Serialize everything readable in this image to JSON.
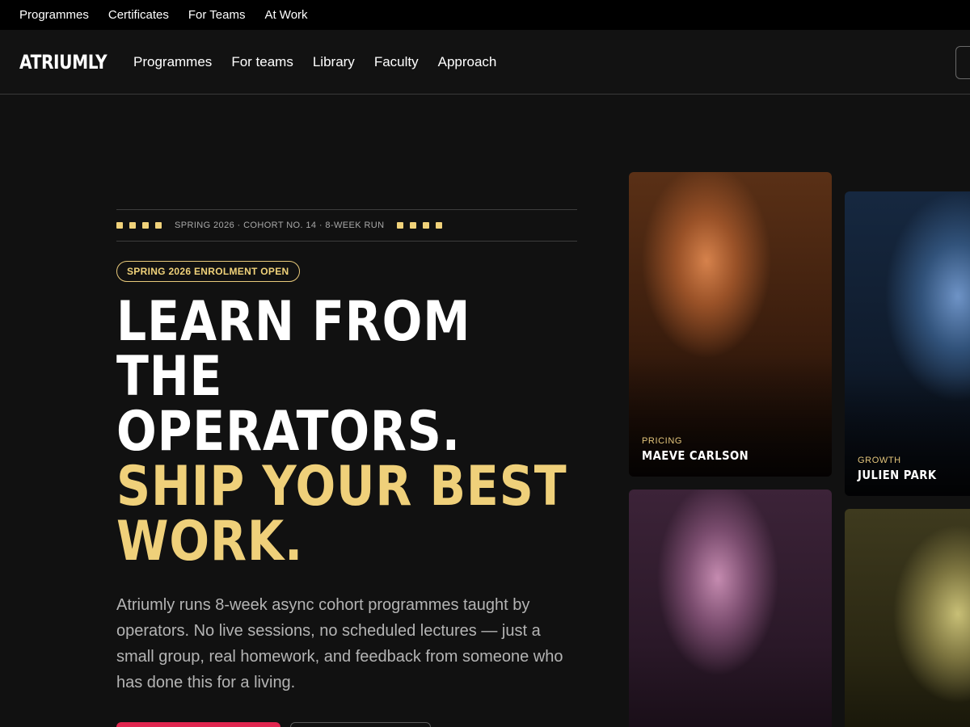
{
  "topbar": {
    "links": [
      "Programmes",
      "Certificates",
      "For Teams",
      "At Work"
    ]
  },
  "nav": {
    "logo": "ATRIUMLY",
    "links": [
      "Programmes",
      "For teams",
      "Library",
      "Faculty",
      "Approach"
    ]
  },
  "hero": {
    "meta": "SPRING 2026 · COHORT NO. 14 · 8-WEEK RUN",
    "badge": "SPRING 2026 ENROLMENT OPEN",
    "headline_white": [
      "LEARN FROM",
      "THE",
      "OPERATORS."
    ],
    "headline_gold": [
      "SHIP YOUR BEST",
      "WORK."
    ],
    "lede": "Atriumly runs 8-week async cohort programmes taught by operators. No live sessions, no scheduled lectures — just a small group, real homework, and feedback from someone who has done this for a living."
  },
  "faculty": [
    {
      "category": "PRICING",
      "name": "MAEVE CARLSON"
    },
    {
      "category": "GROWTH",
      "name": "JULIEN PARK"
    }
  ],
  "colors": {
    "accent_gold": "#efd07a",
    "cta_red": "#e0264f",
    "background": "#111111"
  }
}
